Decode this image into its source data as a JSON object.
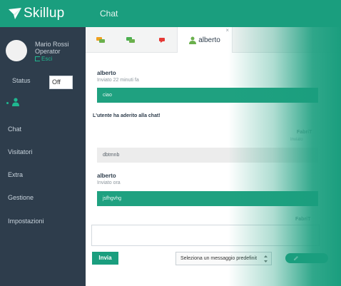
{
  "app": {
    "logo_text": "Skillup",
    "page_title": "Chat"
  },
  "user": {
    "name": "Mario Rossi",
    "role": "Operator",
    "logout_label": "Esci"
  },
  "status": {
    "label": "Status",
    "value": "Off"
  },
  "nav": {
    "items": [
      {
        "label": "Chat"
      },
      {
        "label": "Visitatori"
      },
      {
        "label": "Extra"
      },
      {
        "label": "Gestione"
      },
      {
        "label": "Impostazioni"
      }
    ]
  },
  "tabs": {
    "active_label": "alberto",
    "close_glyph": "×",
    "icon_colors": [
      "#f0a020",
      "#4caf50",
      "#e53935",
      "#6ab04c"
    ]
  },
  "messages": {
    "m1": {
      "author": "alberto",
      "time": "Inviato 22 minuti fa",
      "text": "ciao"
    },
    "system": "L'utente ha aderito alla chat!",
    "m2_author": "FabriT",
    "m2_time": "Inviato",
    "m2_text": "dbtmnb",
    "m3": {
      "author": "alberto",
      "time": "Inviato ora",
      "text": "jsfhgvhg"
    },
    "m4_author": "FabriT"
  },
  "composer": {
    "send_label": "Invia",
    "canned_placeholder": "Seleziona un messaggio predefinit"
  },
  "colors": {
    "brand": "#1a9e7e",
    "sidebar": "#2e3d4c"
  }
}
